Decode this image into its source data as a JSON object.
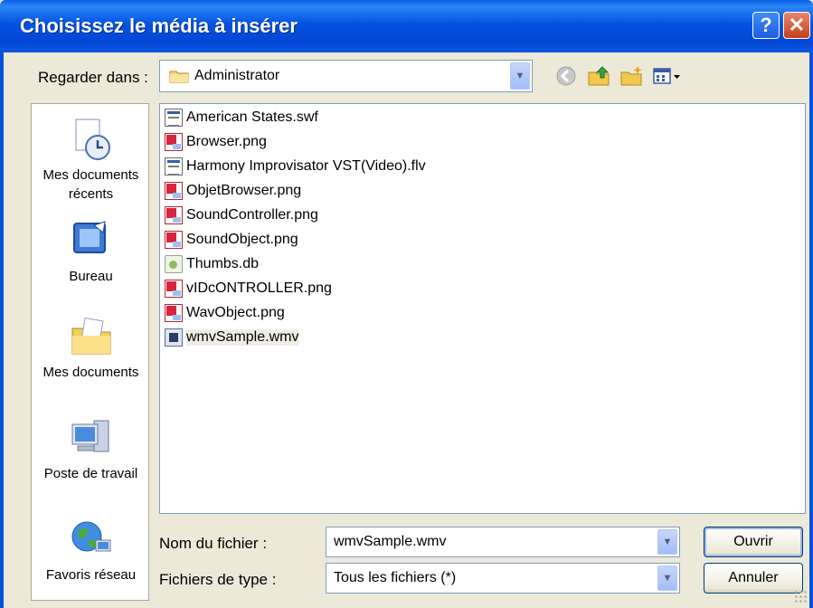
{
  "window": {
    "title": "Choisissez le média à insérer",
    "help_glyph": "?",
    "close_glyph": "✕"
  },
  "look_in": {
    "label": "Regarder dans :",
    "value": "Administrator"
  },
  "places": [
    {
      "label": "Mes documents récents",
      "icon": "recent-documents-icon"
    },
    {
      "label": "Bureau",
      "icon": "desktop-icon"
    },
    {
      "label": "Mes documents",
      "icon": "my-documents-icon"
    },
    {
      "label": "Poste de travail",
      "icon": "my-computer-icon"
    },
    {
      "label": "Favoris réseau",
      "icon": "network-places-icon"
    }
  ],
  "files": [
    {
      "name": "American States.swf",
      "icon": "swf-file-icon"
    },
    {
      "name": "Browser.png",
      "icon": "png-file-icon"
    },
    {
      "name": "Harmony Improvisator VST(Video).flv",
      "icon": "flv-file-icon"
    },
    {
      "name": "ObjetBrowser.png",
      "icon": "png-file-icon"
    },
    {
      "name": "SoundController.png",
      "icon": "png-file-icon"
    },
    {
      "name": "SoundObject.png",
      "icon": "png-file-icon"
    },
    {
      "name": "Thumbs.db",
      "icon": "db-file-icon"
    },
    {
      "name": "vIDcONTROLLER.png",
      "icon": "png-file-icon"
    },
    {
      "name": "WavObject.png",
      "icon": "png-file-icon"
    },
    {
      "name": "wmvSample.wmv",
      "icon": "wmv-file-icon",
      "selected": true
    }
  ],
  "file_name": {
    "label": "Nom du fichier :",
    "value": "wmvSample.wmv"
  },
  "file_type": {
    "label": "Fichiers de type :",
    "value": "Tous les fichiers (*)"
  },
  "buttons": {
    "open": "Ouvrir",
    "cancel": "Annuler"
  },
  "colors": {
    "titlebar": "#0453e2",
    "dialog_bg": "#ece9d8",
    "close_button": "#c6401c"
  }
}
